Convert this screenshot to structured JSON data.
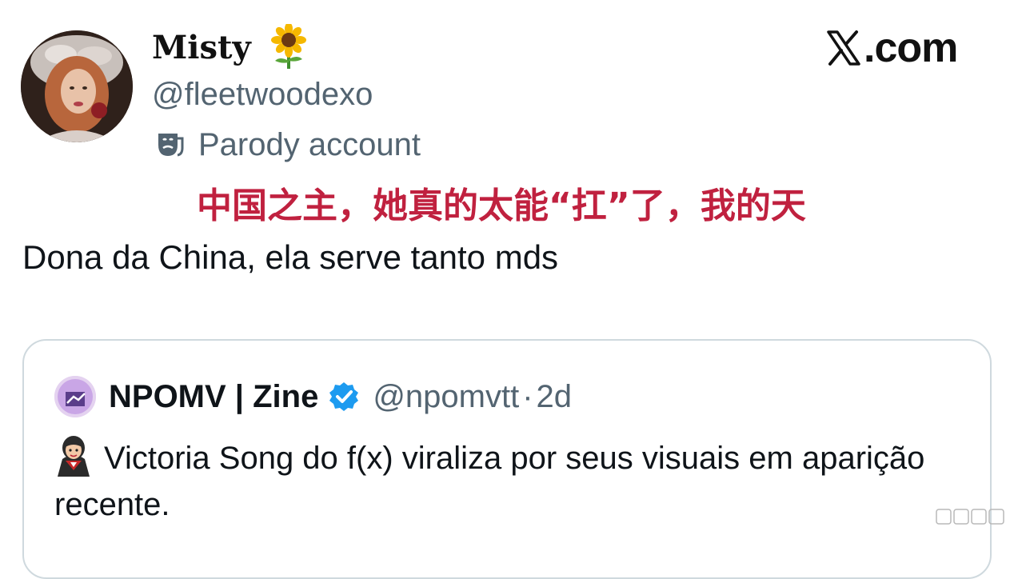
{
  "header": {
    "logo_text": ".com"
  },
  "profile": {
    "display_name": "Misty",
    "name_emoji": "sunflower-icon",
    "handle": "@fleetwoodexo",
    "label_icon": "theater-mask-icon",
    "label": "Parody account"
  },
  "caption": {
    "text": "中国之主，她真的太能“扛”了，我的天",
    "color": "#c0213f"
  },
  "tweet": {
    "text": "Dona da China, ela serve tanto mds"
  },
  "quote": {
    "name": "NPOMV | Zine",
    "verified": true,
    "handle": "@npomvtt",
    "separator": "·",
    "time": "2d",
    "body_icon": "vampire-emoji-icon",
    "body": "Victoria Song do f(x) viraliza por seus visuais em aparição recente."
  },
  "colors": {
    "text_primary": "#0f1419",
    "text_secondary": "#536471",
    "verified_blue": "#1d9bf0",
    "border": "#cfd9de"
  }
}
